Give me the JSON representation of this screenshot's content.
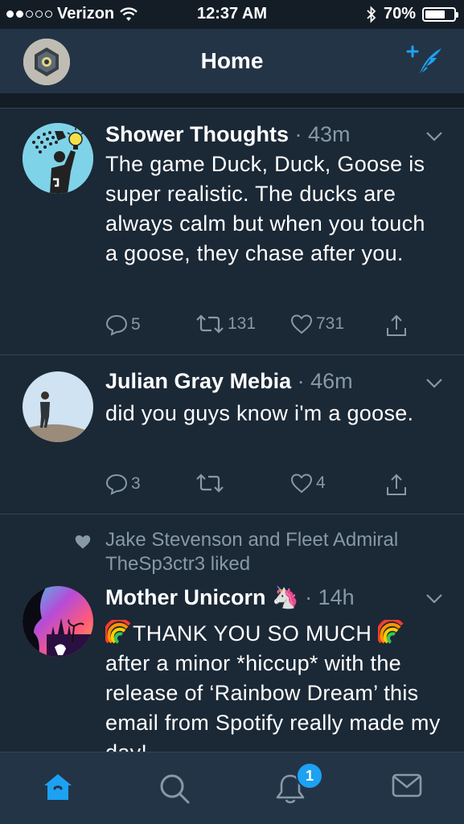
{
  "status_bar": {
    "carrier": "Verizon",
    "time": "12:37 AM",
    "battery": "70%",
    "battery_level": 0.7
  },
  "header": {
    "title": "Home"
  },
  "tweets": [
    {
      "name": "Shower Thoughts",
      "time": "· 43m",
      "text": "The game Duck, Duck, Goose is super realistic. The ducks are always calm but when you touch a goose, they chase after you.",
      "replies": "5",
      "retweets": "131",
      "likes": "731"
    },
    {
      "name": "Julian Gray Mebia",
      "time": "· 46m",
      "text": "did you guys know i'm a goose.",
      "replies": "3",
      "retweets": "",
      "likes": "4"
    },
    {
      "social_context": "Jake Stevenson and Fleet Admiral TheSp3ctr3 liked",
      "name": "Mother Unicorn",
      "name_emoji": "🦄",
      "time": "· 14h",
      "text": "THANK YOU SO MUCH",
      "text_rest": "after a minor *hiccup* with the release of ‘Rainbow Dream’ this email from Spotify really made my day!"
    }
  ],
  "tabbar": {
    "notification_count": "1"
  },
  "colors": {
    "accent": "#1da1f2",
    "background": "#141d26",
    "card": "#1b2836",
    "bar": "#243447",
    "muted": "#8899a6"
  }
}
